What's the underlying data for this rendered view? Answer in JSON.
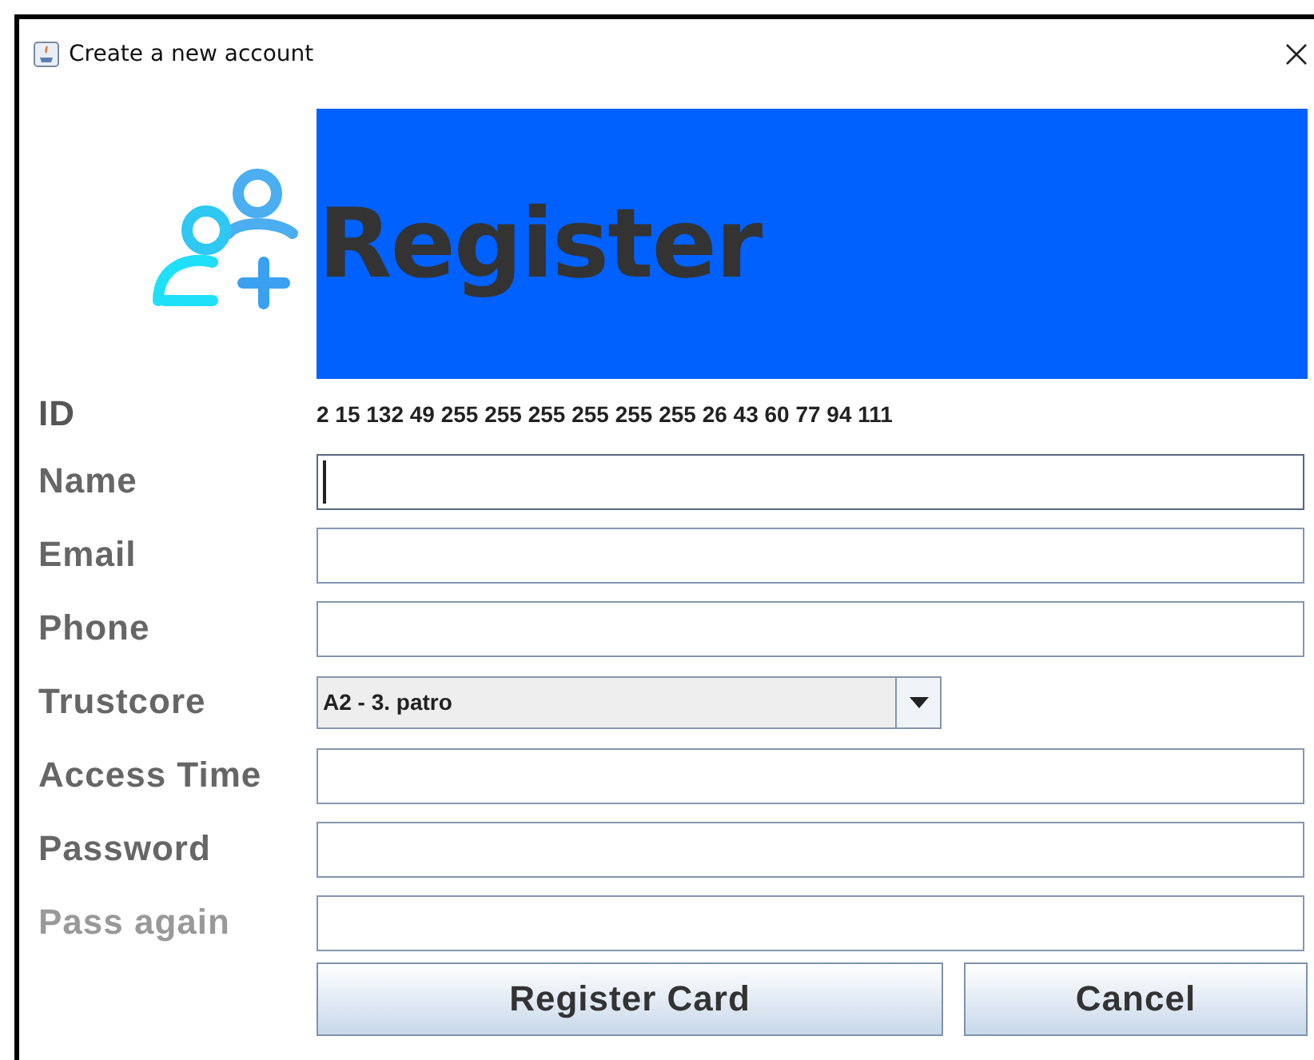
{
  "window": {
    "title": "Create a new account"
  },
  "banner": {
    "title": "Register"
  },
  "fields": [
    {
      "kind": "text",
      "label": "ID",
      "value": "2 15 132 49 255 255 255 255 255 255 26 43 60 77 94 111",
      "disabled": false
    },
    {
      "kind": "input",
      "label": "Name",
      "focused": true,
      "disabled": false
    },
    {
      "kind": "input",
      "label": "Email",
      "focused": false,
      "disabled": false
    },
    {
      "kind": "input",
      "label": "Phone",
      "focused": false,
      "disabled": false
    },
    {
      "kind": "select",
      "label": "Trustcore",
      "value": "A2 - 3. patro",
      "disabled": false
    },
    {
      "kind": "input",
      "label": "Access Time",
      "focused": false,
      "disabled": false
    },
    {
      "kind": "input",
      "label": "Password",
      "focused": false,
      "disabled": false
    },
    {
      "kind": "input",
      "label": "Pass again",
      "focused": false,
      "disabled": true
    }
  ],
  "buttons": [
    {
      "label": "Register Card",
      "kind": "wide"
    },
    {
      "label": "Cancel",
      "kind": "normal"
    }
  ]
}
